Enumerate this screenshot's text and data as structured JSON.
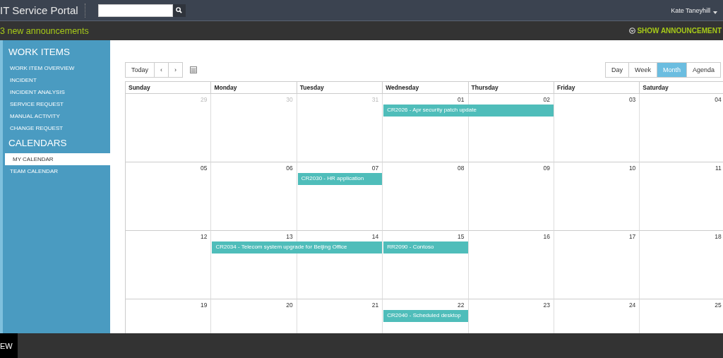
{
  "header": {
    "title": "IT Service Portal",
    "user": "Kate Taneyhill"
  },
  "announcements": {
    "count_text": "3 new announcements",
    "toggle": "SHOW ANNOUNCEMENT"
  },
  "sidebar": {
    "sections": [
      {
        "heading": "WORK ITEMS",
        "items": [
          {
            "label": "WORK ITEM OVERVIEW",
            "selected": false
          },
          {
            "label": "INCIDENT",
            "selected": false
          },
          {
            "label": "INCIDENT ANALYSIS",
            "selected": false
          },
          {
            "label": "SERVICE REQUEST",
            "selected": false
          },
          {
            "label": "MANUAL ACTIVITY",
            "selected": false
          },
          {
            "label": "CHANGE REQUEST",
            "selected": false
          }
        ]
      },
      {
        "heading": "CALENDARS",
        "items": [
          {
            "label": "MY CALENDAR",
            "selected": true
          },
          {
            "label": "TEAM CALENDAR",
            "selected": false
          }
        ]
      }
    ]
  },
  "toolbar": {
    "today": "Today",
    "prev": "‹",
    "next": "›",
    "views": [
      {
        "label": "Day",
        "selected": false
      },
      {
        "label": "Week",
        "selected": false
      },
      {
        "label": "Month",
        "selected": true
      },
      {
        "label": "Agenda",
        "selected": false
      }
    ]
  },
  "calendar": {
    "weekdays": [
      "Sunday",
      "Monday",
      "Tuesday",
      "Wednesday",
      "Thursday",
      "Friday",
      "Saturday"
    ],
    "weeks": [
      {
        "days": [
          {
            "date": "29",
            "other_month": true
          },
          {
            "date": "30",
            "other_month": true
          },
          {
            "date": "31",
            "other_month": true
          },
          {
            "date": "01",
            "other_month": false,
            "events": [
              {
                "title": "CR2026 - Apr security patch update",
                "kind": "two-day"
              }
            ]
          },
          {
            "date": "02",
            "other_month": false
          },
          {
            "date": "03",
            "other_month": false
          },
          {
            "date": "04",
            "other_month": false
          }
        ]
      },
      {
        "days": [
          {
            "date": "05",
            "other_month": false
          },
          {
            "date": "06",
            "other_month": false
          },
          {
            "date": "07",
            "other_month": false,
            "events": [
              {
                "title": "CR2030 - HR application",
                "kind": "one-day"
              }
            ]
          },
          {
            "date": "08",
            "other_month": false
          },
          {
            "date": "09",
            "other_month": false
          },
          {
            "date": "10",
            "other_month": false
          },
          {
            "date": "11",
            "other_month": false
          }
        ]
      },
      {
        "days": [
          {
            "date": "12",
            "other_month": false
          },
          {
            "date": "13",
            "other_month": false,
            "events": [
              {
                "title": "CR2034 - Telecom system upgrade for Beijing Office",
                "kind": "two-day"
              }
            ]
          },
          {
            "date": "14",
            "other_month": false
          },
          {
            "date": "15",
            "other_month": false,
            "events": [
              {
                "title": "RR2090 - Contoso",
                "kind": "one-day"
              }
            ]
          },
          {
            "date": "16",
            "other_month": false
          },
          {
            "date": "17",
            "other_month": false
          },
          {
            "date": "18",
            "other_month": false
          }
        ]
      },
      {
        "days": [
          {
            "date": "19",
            "other_month": false
          },
          {
            "date": "20",
            "other_month": false
          },
          {
            "date": "21",
            "other_month": false
          },
          {
            "date": "22",
            "other_month": false,
            "events": [
              {
                "title": "CR2040 - Scheduled desktop",
                "kind": "one-day"
              }
            ]
          },
          {
            "date": "23",
            "other_month": false
          },
          {
            "date": "24",
            "other_month": false
          },
          {
            "date": "25",
            "other_month": false
          }
        ]
      }
    ]
  },
  "footer": {
    "label": "EW"
  }
}
